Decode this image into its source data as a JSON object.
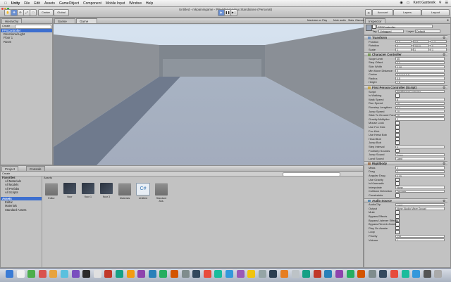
{
  "menubar": {
    "items": [
      "",
      "Unity",
      "File",
      "Edit",
      "Assets",
      "GameObject",
      "Component",
      "Mobile Input",
      "Window",
      "Help"
    ],
    "user": "Kent Gantevik"
  },
  "window": {
    "title": "Untitled - mkpainingame - PC, Mac & Linux Standalone (Personal)"
  },
  "toolbar": {
    "center_label": "Center",
    "global_label": "Global",
    "account_label": "Account",
    "layers_label": "Layers",
    "layout_label": "Layout"
  },
  "hierarchy": {
    "tab": "Hierarchy",
    "create": "Create",
    "items": [
      "Directional Light",
      "Floor 1",
      "Room"
    ],
    "selected": "FPSController"
  },
  "scene": {
    "tab_scene": "Scene",
    "tab_game": "Game",
    "aspect": "Maximize on Play",
    "mute": "Mute audio",
    "stats": "Stats",
    "gizmos": "Gizmos"
  },
  "inspector": {
    "tab": "Inspector",
    "object_name": "FPSController",
    "tag_label": "Tag",
    "tag_value": "Untagged",
    "layer_label": "Layer",
    "layer_value": "Default",
    "transform": {
      "title": "Transform",
      "rows": [
        {
          "label": "Position",
          "x": "0.3",
          "y": "0.9",
          "z": "1.3"
        },
        {
          "label": "Rotation",
          "x": "0",
          "y": "269.9",
          "z": "0"
        },
        {
          "label": "Scale",
          "x": "1",
          "y": "1",
          "z": "1"
        }
      ]
    },
    "character_controller": {
      "title": "Character Controller",
      "rows": [
        {
          "label": "Slope Limit",
          "value": "45"
        },
        {
          "label": "Step Offset",
          "value": "0.3"
        },
        {
          "label": "Skin Width",
          "value": "0.08"
        },
        {
          "label": "Min Move Distance",
          "value": "0"
        },
        {
          "label": "Center",
          "value": "X 0   Y 0   Z 0"
        },
        {
          "label": "Radius",
          "value": "0.5"
        },
        {
          "label": "Height",
          "value": "1.8"
        }
      ]
    },
    "fps_controller": {
      "title": "First Person Controller (Script)",
      "rows": [
        {
          "label": "Script",
          "value": "FirstPersonController"
        },
        {
          "label": "Is Walking",
          "value": ""
        },
        {
          "label": "Walk Speed",
          "value": "5"
        },
        {
          "label": "Run Speed",
          "value": "10"
        },
        {
          "label": "Runstep Lengthen",
          "value": "0.7"
        },
        {
          "label": "Jump Speed",
          "value": "10"
        },
        {
          "label": "Stick To Ground Force",
          "value": "10"
        },
        {
          "label": "Gravity Multiplier",
          "value": "2"
        },
        {
          "label": "Mouse Look",
          "value": ""
        },
        {
          "label": "Use Fov Kick",
          "value": ""
        },
        {
          "label": "Fov Kick",
          "value": ""
        },
        {
          "label": "Use Head Bob",
          "value": ""
        },
        {
          "label": "Head Bob",
          "value": ""
        },
        {
          "label": "Jump Bob",
          "value": ""
        },
        {
          "label": "Step Interval",
          "value": "5"
        },
        {
          "label": "Footstep Sounds",
          "value": ""
        },
        {
          "label": "Jump Sound",
          "value": "Jump"
        },
        {
          "label": "Land Sound",
          "value": "Land"
        }
      ]
    },
    "rigidbody": {
      "title": "Rigidbody",
      "rows": [
        {
          "label": "Mass",
          "value": "1"
        },
        {
          "label": "Drag",
          "value": "0"
        },
        {
          "label": "Angular Drag",
          "value": "0.05"
        },
        {
          "label": "Use Gravity",
          "value": ""
        },
        {
          "label": "Is Kinematic",
          "value": ""
        },
        {
          "label": "Interpolate",
          "value": "None"
        },
        {
          "label": "Collision Detection",
          "value": "Discrete"
        },
        {
          "label": "Constraints",
          "value": ""
        }
      ]
    },
    "audio_source": {
      "title": "Audio Source",
      "rows": [
        {
          "label": "AudioClip",
          "value": "Land"
        },
        {
          "label": "Output",
          "value": "None (Audio Mixer Group)"
        },
        {
          "label": "Mute",
          "value": ""
        },
        {
          "label": "Bypass Effects",
          "value": ""
        },
        {
          "label": "Bypass Listener Effects",
          "value": ""
        },
        {
          "label": "Bypass Reverb Zones",
          "value": ""
        },
        {
          "label": "Play On Awake",
          "value": ""
        },
        {
          "label": "Loop",
          "value": ""
        },
        {
          "label": "Priority",
          "value": "128"
        },
        {
          "label": "Volume",
          "value": "1"
        }
      ]
    }
  },
  "project": {
    "tab_project": "Project",
    "tab_console": "Console",
    "create": "Create",
    "favorites_title": "Favorites",
    "favorites": [
      "All Materials",
      "All Models",
      "All Prefabs",
      "All Scripts"
    ],
    "assets_title": "Assets",
    "folders": [
      "Editor",
      "Materials",
      "Standard Assets"
    ],
    "breadcrumb": "Assets",
    "assets": [
      {
        "name": "Editor",
        "kind": "folder"
      },
      {
        "name": "floor",
        "kind": "model"
      },
      {
        "name": "floor 1",
        "kind": "model"
      },
      {
        "name": "floor 3",
        "kind": "model"
      },
      {
        "name": "Materials",
        "kind": "folder"
      },
      {
        "name": "Untitled",
        "kind": "script"
      },
      {
        "name": "Standard Ass.",
        "kind": "folder"
      }
    ]
  }
}
